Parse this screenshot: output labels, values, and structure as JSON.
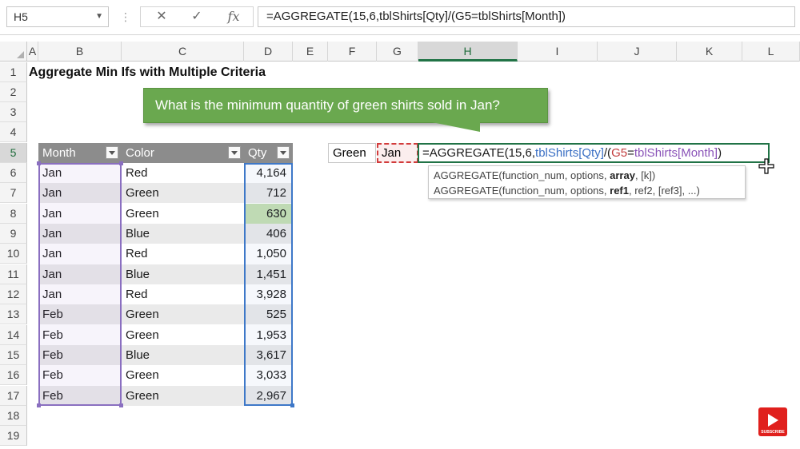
{
  "formula_bar": {
    "name_box": "H5",
    "cancel_icon": "✕",
    "enter_icon": "✓",
    "fx_icon": "fx",
    "formula": "=AGGREGATE(15,6,tblShirts[Qty]/(G5=tblShirts[Month])"
  },
  "columns": [
    "A",
    "B",
    "C",
    "D",
    "E",
    "F",
    "G",
    "H",
    "I",
    "J",
    "K",
    "L"
  ],
  "rows": [
    "1",
    "2",
    "3",
    "4",
    "5",
    "6",
    "7",
    "8",
    "9",
    "10",
    "11",
    "12",
    "13",
    "14",
    "15",
    "16",
    "17",
    "18",
    "19"
  ],
  "title": "Aggregate Min Ifs with Multiple Criteria",
  "callout": "What is the minimum quantity of green shirts sold in Jan?",
  "table": {
    "headers": [
      "Month",
      "Color",
      "Qty"
    ],
    "rows": [
      {
        "month": "Jan",
        "color": "Red",
        "qty": "4,164"
      },
      {
        "month": "Jan",
        "color": "Green",
        "qty": "712"
      },
      {
        "month": "Jan",
        "color": "Green",
        "qty": "630"
      },
      {
        "month": "Jan",
        "color": "Blue",
        "qty": "406"
      },
      {
        "month": "Jan",
        "color": "Red",
        "qty": "1,050"
      },
      {
        "month": "Jan",
        "color": "Blue",
        "qty": "1,451"
      },
      {
        "month": "Jan",
        "color": "Red",
        "qty": "3,928"
      },
      {
        "month": "Feb",
        "color": "Green",
        "qty": "525"
      },
      {
        "month": "Feb",
        "color": "Green",
        "qty": "1,953"
      },
      {
        "month": "Feb",
        "color": "Blue",
        "qty": "3,617"
      },
      {
        "month": "Feb",
        "color": "Green",
        "qty": "3,033"
      },
      {
        "month": "Feb",
        "color": "Green",
        "qty": "2,967"
      }
    ]
  },
  "criteria": {
    "color": "Green",
    "month": "Jan"
  },
  "cell_formula": {
    "part1": "=AGGREGATE(15,6,",
    "part2": "tblShirts[Qty]",
    "part3": "/(",
    "part4": "G5",
    "part5": "=",
    "part6": "tblShirts[Month]",
    "part7": ")"
  },
  "tooltip": {
    "line1_pre": "AGGREGATE(function_num, options, ",
    "line1_bold": "array",
    "line1_post": ", [k])",
    "line2_pre": "AGGREGATE(function_num, options, ",
    "line2_bold": "ref1",
    "line2_post": ", ref2, [ref3], ...)"
  },
  "subscribe_label": "SUBSCRIBE",
  "colors": {
    "accent": "#217346",
    "callout": "#6aa84f",
    "table_header": "#8c8c8c",
    "month_highlight": "#8a6fc0",
    "qty_highlight": "#3e78c8",
    "criteria_highlight": "#d23b3b"
  }
}
